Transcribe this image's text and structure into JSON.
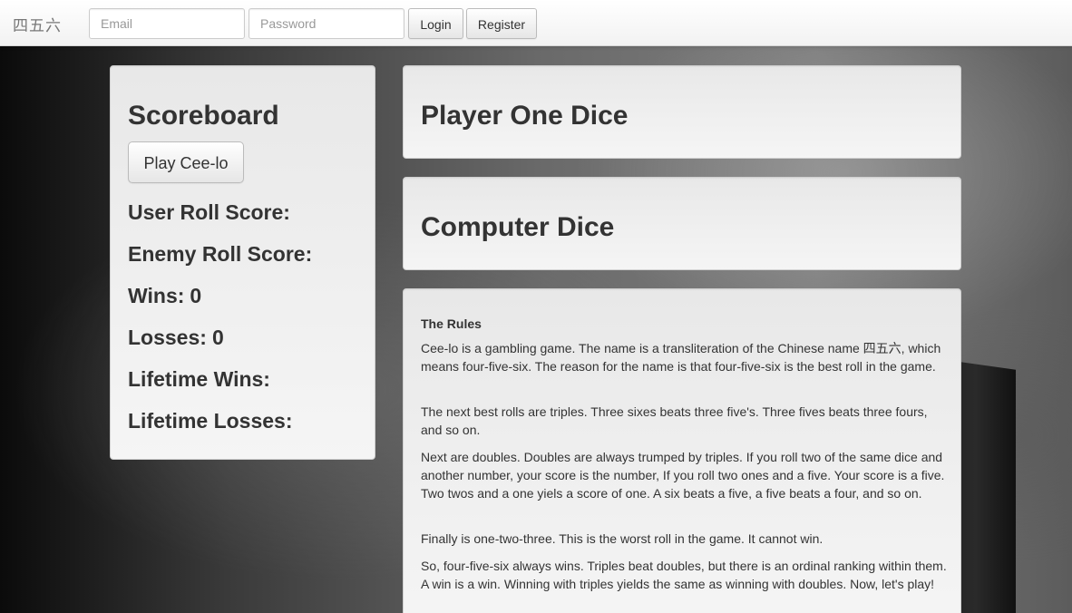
{
  "navbar": {
    "brand": "四五六",
    "email_placeholder": "Email",
    "password_placeholder": "Password",
    "login_label": "Login",
    "register_label": "Register"
  },
  "scoreboard": {
    "title": "Scoreboard",
    "play_button_label": "Play Cee-lo",
    "user_roll_label": "User Roll Score:",
    "user_roll_value": "",
    "enemy_roll_label": "Enemy Roll Score:",
    "enemy_roll_value": "",
    "wins_label": "Wins:",
    "wins_value": "0",
    "losses_label": "Losses:",
    "losses_value": "0",
    "lifetime_wins_label": "Lifetime Wins:",
    "lifetime_wins_value": "",
    "lifetime_losses_label": "Lifetime Losses:",
    "lifetime_losses_value": ""
  },
  "player_dice": {
    "title": "Player One Dice"
  },
  "computer_dice": {
    "title": "Computer Dice"
  },
  "rules": {
    "heading": "The Rules",
    "paragraphs": [
      "Cee-lo is a gambling game. The name is a transliteration of the Chinese name 四五六, which means four-five-six. The reason for the name is that four-five-six is the best roll in the game.",
      "The next best rolls are triples. Three sixes beats three five's. Three fives beats three fours, and so on.",
      "Next are doubles. Doubles are always trumped by triples. If you roll two of the same dice and another number, your score is the number, If you roll two ones and a five. Your score is a five. Two twos and a one yiels a score of one. A six beats a five, a five beats a four, and so on.",
      "Finally is one-two-three. This is the worst roll in the game. It cannot win.",
      "So, four-five-six always wins. Triples beat doubles, but there is an ordinal ranking within them. A win is a win. Winning with triples yields the same as winning with doubles. Now, let's play!"
    ]
  }
}
